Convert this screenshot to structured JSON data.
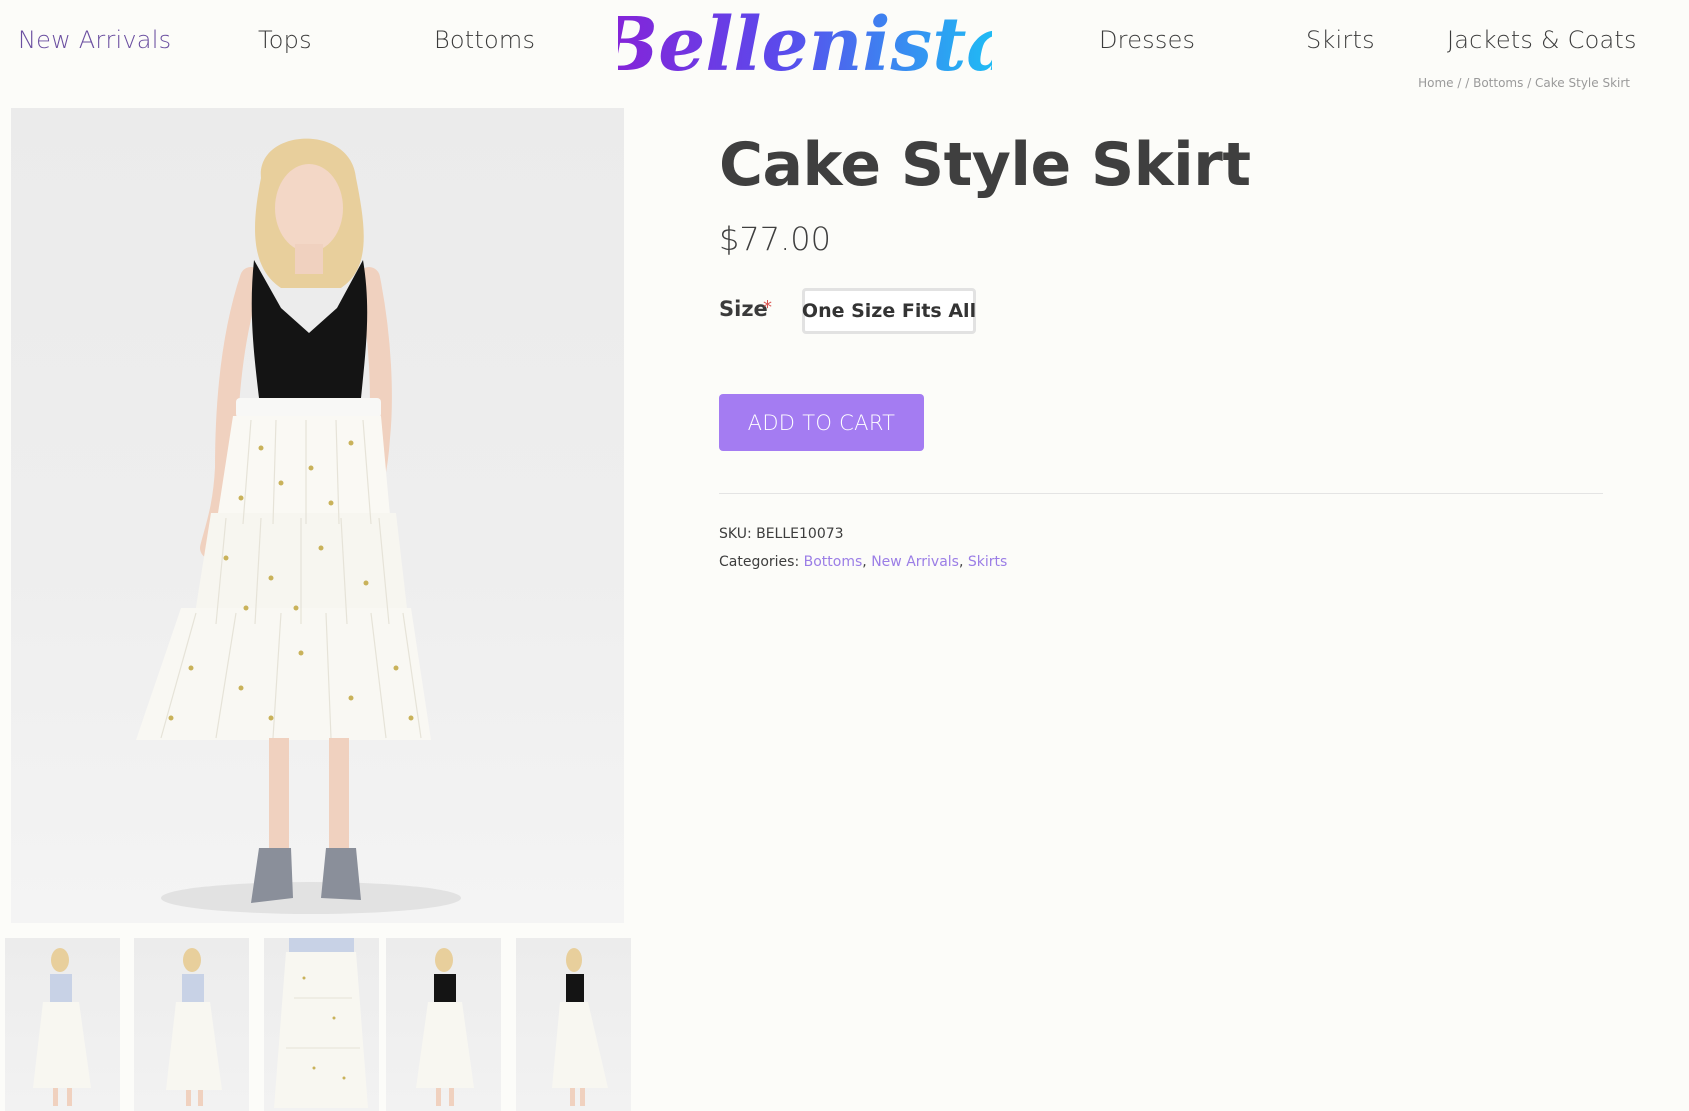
{
  "nav": {
    "left": [
      "New Arrivals",
      "Tops",
      "Bottoms"
    ],
    "right": [
      "Dresses",
      "Skirts",
      "Jackets & Coats"
    ],
    "active": "New Arrivals"
  },
  "logo": {
    "text": "Bellenista",
    "gradient": [
      "#8a1fd6",
      "#3f6ff0",
      "#19c7f5"
    ]
  },
  "breadcrumb": {
    "home": "Home",
    "sep1": " / ",
    "empty": "",
    "sep2": " / ",
    "category": "Bottoms",
    "sep3": " / ",
    "current": "Cake Style Skirt"
  },
  "product": {
    "title": "Cake Style Skirt",
    "price": "$77.00",
    "size_label": "Size",
    "required_mark": "*",
    "size_value": "One Size Fits All",
    "add_to_cart": "ADD TO CART",
    "sku_label": "SKU:",
    "sku": "BELLE10073",
    "categories_label": "Categories:",
    "categories": [
      "Bottoms",
      "New Arrivals",
      "Skirts"
    ],
    "category_sep": ", "
  },
  "colors": {
    "accent": "#a47cf2",
    "link": "#9b7ee6",
    "active_nav": "#6a4ea0",
    "required": "#d9534f"
  },
  "gallery": {
    "main_alt": "Model wearing tiered white cake style skirt with black top",
    "thumb_count": 5
  }
}
